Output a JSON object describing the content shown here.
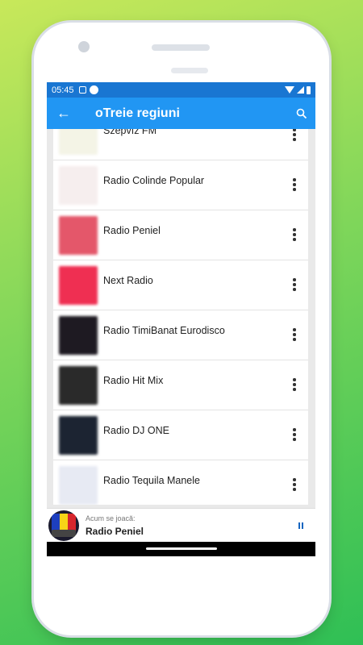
{
  "status_bar": {
    "time": "05:45"
  },
  "toolbar": {
    "back_icon": "arrow-left-icon",
    "title": "oTreie regiuni",
    "search_icon": "search-icon"
  },
  "stations": [
    {
      "name": "Szépvíz FM",
      "logo_color": "#f4f4e6"
    },
    {
      "name": "Radio Colinde Popular",
      "logo_color": "#f6eeee"
    },
    {
      "name": "Radio Peniel",
      "logo_color": "#e4576a"
    },
    {
      "name": "Next Radio",
      "logo_color": "#ef2f52"
    },
    {
      "name": "Radio TimiBanat Eurodisco",
      "logo_color": "#1e1a22"
    },
    {
      "name": "Radio Hit Mix",
      "logo_color": "#2a2a2a"
    },
    {
      "name": "Radio DJ ONE",
      "logo_color": "#1c2432"
    },
    {
      "name": "Radio Tequila Manele",
      "logo_color": "#e7eaf3"
    }
  ],
  "player": {
    "label": "Acum se joacă:",
    "title": "Radio Peniel"
  },
  "colors": {
    "primary": "#2196f3",
    "primary_dark": "#1976d2"
  }
}
